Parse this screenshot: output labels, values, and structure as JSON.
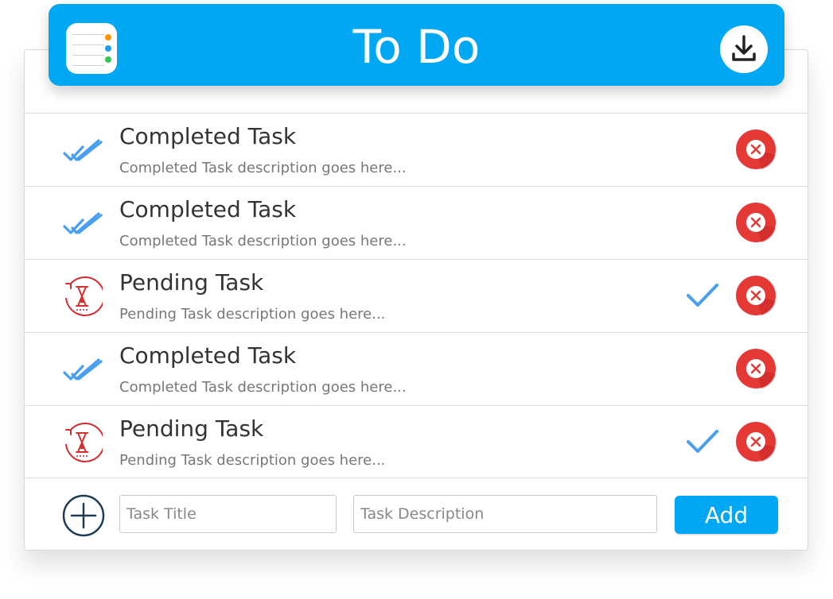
{
  "header": {
    "title": "To Do",
    "app_icon": "reminders-list-icon",
    "download_icon": "download-icon",
    "color": "#00a8f3"
  },
  "tasks": [
    {
      "status": "completed",
      "title": "Completed Task",
      "description": "Completed Task description goes here...",
      "status_icon": "double-check-icon",
      "delete_icon": "delete-icon"
    },
    {
      "status": "completed",
      "title": "Completed Task",
      "description": "Completed Task description goes here...",
      "status_icon": "double-check-icon",
      "delete_icon": "delete-icon"
    },
    {
      "status": "pending",
      "title": "Pending Task",
      "description": "Pending Task description goes here...",
      "status_icon": "hourglass-icon",
      "complete_icon": "check-icon",
      "delete_icon": "delete-icon"
    },
    {
      "status": "completed",
      "title": "Completed Task",
      "description": "Completed Task description goes here...",
      "status_icon": "double-check-icon",
      "delete_icon": "delete-icon"
    },
    {
      "status": "pending",
      "title": "Pending Task",
      "description": "Pending Task description goes here...",
      "status_icon": "hourglass-icon",
      "complete_icon": "check-icon",
      "delete_icon": "delete-icon"
    }
  ],
  "footer": {
    "add_icon": "plus-circle-icon",
    "title_placeholder": "Task Title",
    "title_value": "",
    "description_placeholder": "Task Description",
    "description_value": "",
    "add_label": "Add"
  },
  "colors": {
    "accent": "#00a8f3",
    "completed": "#4a9ef0",
    "pending": "#d32f2f",
    "delete": "#e53935"
  }
}
